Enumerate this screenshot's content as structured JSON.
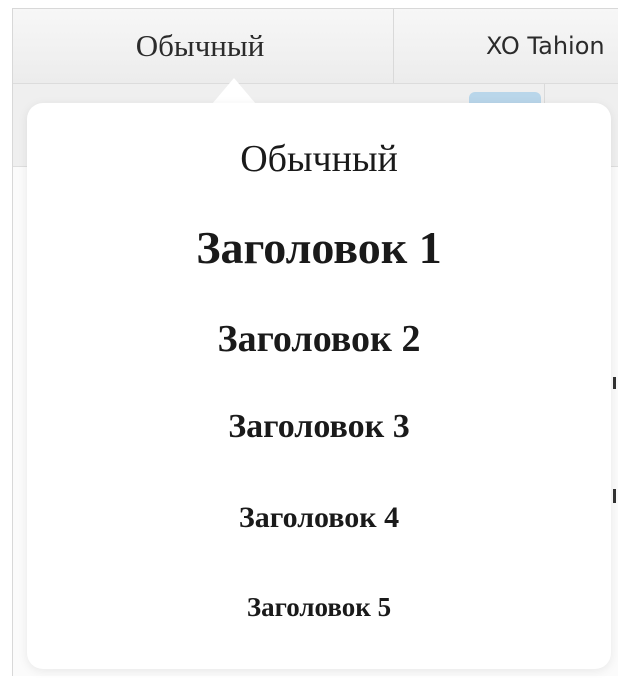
{
  "toolbar": {
    "style_label": "Обычный",
    "font_label": "XO Tahion"
  },
  "style_menu": {
    "options": [
      "Обычный",
      "Заголовок 1",
      "Заголовок 2",
      "Заголовок 3",
      "Заголовок 4",
      "Заголовок 5"
    ]
  },
  "colors": {
    "toolbar_bg": "#efefef",
    "popover_bg": "#ffffff",
    "selected_button": "#b9d6ea",
    "text": "#1a1a1a"
  }
}
